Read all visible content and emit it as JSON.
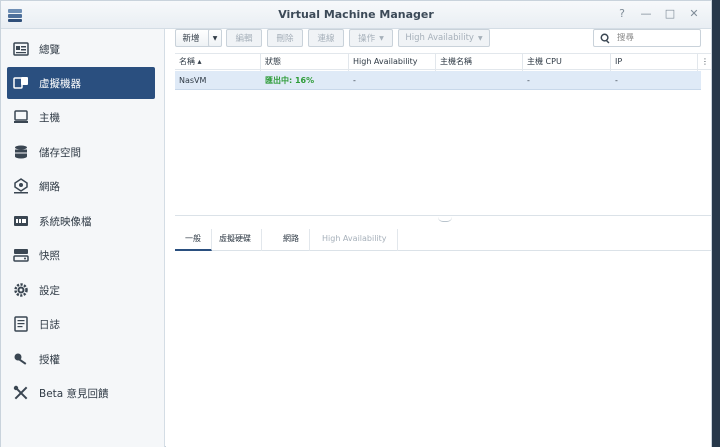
{
  "window": {
    "title": "Virtual Machine Manager"
  },
  "window_buttons": {
    "help": "?",
    "minimize": "—",
    "maximize": "□",
    "close": "✕"
  },
  "sidebar": {
    "items": [
      {
        "label": "總覽",
        "icon": "overview-icon"
      },
      {
        "label": "虛擬機器",
        "icon": "vm-icon",
        "active": true
      },
      {
        "label": "主機",
        "icon": "host-icon"
      },
      {
        "label": "儲存空間",
        "icon": "storage-icon"
      },
      {
        "label": "網路",
        "icon": "network-icon"
      },
      {
        "label": "系統映像檔",
        "icon": "image-icon"
      },
      {
        "label": "快照",
        "icon": "snapshot-icon"
      },
      {
        "label": "設定",
        "icon": "gear-icon"
      },
      {
        "label": "日誌",
        "icon": "log-icon"
      },
      {
        "label": "授權",
        "icon": "key-icon"
      },
      {
        "label": "Beta 意見回饋",
        "icon": "tools-icon"
      }
    ]
  },
  "toolbar": {
    "new": "新增",
    "edit": "編輯",
    "delete": "刪除",
    "connect": "連線",
    "action": "操作",
    "high_availability": "High Availability",
    "search_placeholder": "搜尋"
  },
  "table": {
    "columns": [
      "名稱 ▴",
      "狀態",
      "High Availability",
      "主機名稱",
      "主機 CPU",
      "IP"
    ],
    "rows": [
      {
        "name": "NasVM",
        "status": "匯出中: 16%",
        "ha": "-",
        "host": "",
        "cpu": "-",
        "ip": "-"
      }
    ]
  },
  "detail_tabs": [
    "一般",
    "虛擬硬碟",
    "網路",
    "High Availability"
  ],
  "colors": {
    "accent": "#2a4f7f",
    "running": "#2e9c38",
    "selected_row": "#dfeaf7"
  }
}
